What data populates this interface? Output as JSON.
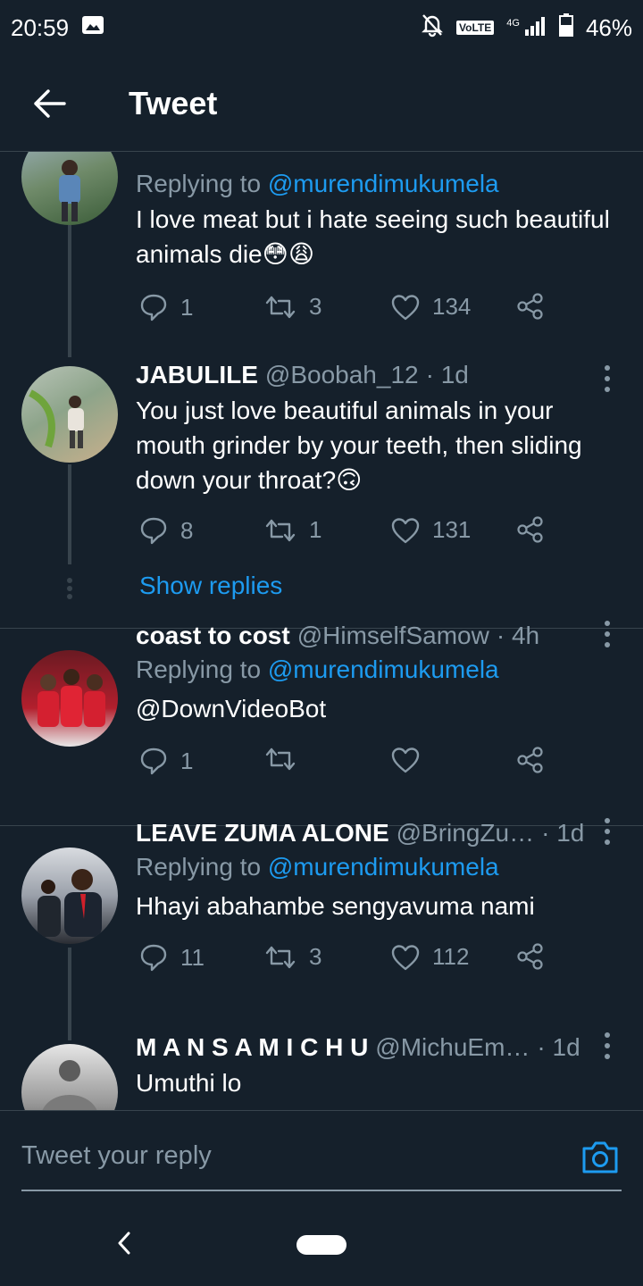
{
  "status_bar": {
    "time": "20:59",
    "volte": "VoLTE",
    "network": "4G",
    "battery": "46%",
    "icons": [
      "image-icon",
      "mute-icon",
      "signal-icon",
      "battery-icon"
    ]
  },
  "header": {
    "title": "Tweet",
    "back_icon": "arrow-left-icon"
  },
  "tweets": [
    {
      "replying_label": "Replying to ",
      "replying_to": "@murendimukumela",
      "text": "I love meat but i hate seeing such beautiful animals die😳😩",
      "replies": "1",
      "retweets": "3",
      "likes": "134"
    },
    {
      "name": "JABULILE",
      "handle": "@Boobah_12",
      "time": "· 1d",
      "text": "You just love beautiful animals in your mouth grinder by your teeth, then sliding down your throat?🙃",
      "replies": "8",
      "retweets": "1",
      "likes": "131"
    },
    {
      "name": "coast to cost",
      "handle": "@HimselfSamow",
      "time": "· 4h",
      "replying_label": "Replying to ",
      "replying_to": "@murendimukumela",
      "text": "@DownVideoBot",
      "replies": "1",
      "retweets": "",
      "likes": ""
    },
    {
      "name": "LEAVE ZUMA ALONE",
      "handle": "@BringZu…",
      "time": "· 1d",
      "replying_label": "Replying to ",
      "replying_to": "@murendimukumela",
      "text": "Hhayi abahambe sengyavuma nami",
      "replies": "11",
      "retweets": "3",
      "likes": "112"
    },
    {
      "name": "M A N S A M I C H U",
      "handle": "@MichuEm…",
      "time": "· 1d",
      "text": "Umuthi lo"
    }
  ],
  "show_replies": "Show replies",
  "reply_bar": {
    "placeholder": "Tweet your reply",
    "camera_icon": "camera-icon"
  },
  "colors": {
    "background": "#15202b",
    "accent": "#1d9bf0",
    "muted": "#8899a6",
    "divider": "#38444d"
  }
}
